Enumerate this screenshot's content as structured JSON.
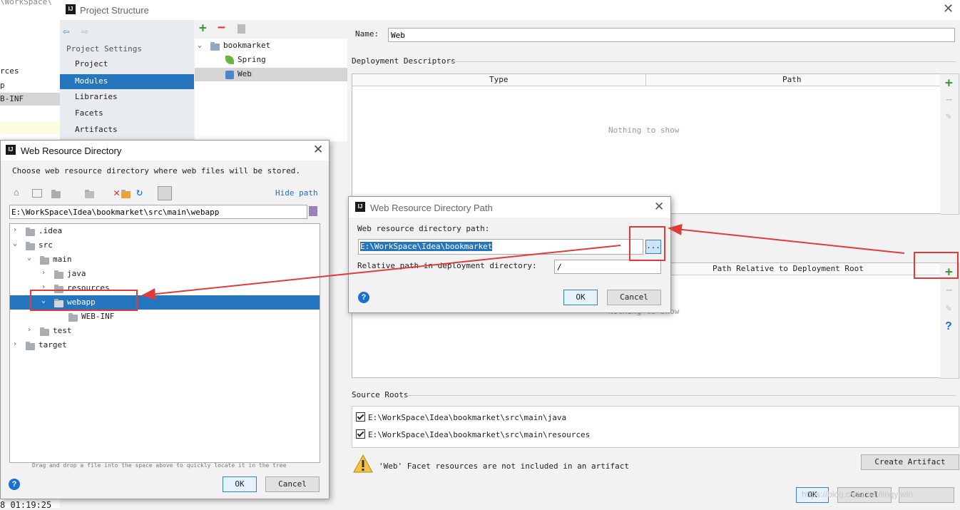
{
  "bg": {
    "left_frag": [
      "rces",
      "p",
      "B-INF"
    ],
    "status_time": "8 01:19:25"
  },
  "ps": {
    "title": "Project Structure",
    "section": "Project Settings",
    "nav": [
      "Project",
      "Modules",
      "Libraries",
      "Facets",
      "Artifacts"
    ],
    "tree": {
      "root": "bookmarket",
      "children": [
        "Spring",
        "Web"
      ]
    },
    "name_label": "Name:",
    "name_value": "Web",
    "dd_label": "Deployment Descriptors",
    "dd_cols": [
      "Type",
      "Path"
    ],
    "empty": "Nothing to show",
    "wr_col": "Path Relative to Deployment Root",
    "wr_empty_partial": "Nothing to show",
    "source_roots_label": "Source Roots",
    "source_roots": [
      "E:\\WorkSpace\\Idea\\bookmarket\\src\\main\\java",
      "E:\\WorkSpace\\Idea\\bookmarket\\src\\main\\resources"
    ],
    "warning": "'Web' Facet resources are not included in an artifact",
    "create_artifact": "Create Artifact",
    "ok": "OK",
    "cancel": "Cancel",
    "watermark": "https://blog.csdn.net/lingyiwin"
  },
  "wrd": {
    "title": "Web Resource Directory",
    "desc": "Choose web resource directory where web files will be stored.",
    "hide_path": "Hide path",
    "path": "E:\\WorkSpace\\Idea\\bookmarket\\src\\main\\webapp",
    "tree": [
      ".idea",
      "src",
      "main",
      "java",
      "resources",
      "webapp",
      "WEB-INF",
      "test",
      "target"
    ],
    "hint": "Drag and drop a file into the space above to quickly locate it in the tree",
    "ok": "OK",
    "cancel": "Cancel"
  },
  "wrdp": {
    "title": "Web Resource Directory Path",
    "label": "Web resource directory path:",
    "path_value": "E:\\WorkSpace\\Idea\\bookmarket",
    "browse": "...",
    "rel_label": "Relative path in deployment directory:",
    "rel_value": "/",
    "ok": "OK",
    "cancel": "Cancel"
  },
  "colors": {
    "selection": "#2675bf",
    "accent_red": "#e03b3b",
    "add_green": "#3a9a3a"
  }
}
